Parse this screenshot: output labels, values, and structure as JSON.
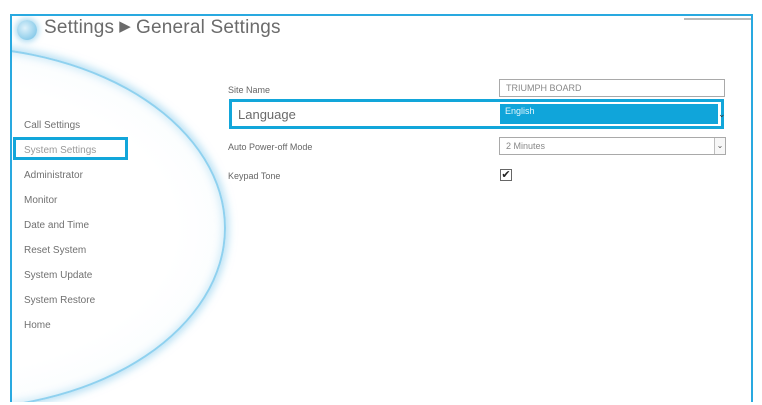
{
  "header": {
    "breadcrumb_root": "Settings",
    "breadcrumb_separator": "▶",
    "breadcrumb_current": "General Settings",
    "icon": "gear-icon"
  },
  "sidebar": {
    "items": [
      {
        "label": "Call Settings"
      },
      {
        "label": "System Settings",
        "active": true
      },
      {
        "label": "Administrator"
      },
      {
        "label": "Monitor"
      },
      {
        "label": "Date and Time"
      },
      {
        "label": "Reset System"
      },
      {
        "label": "System Update"
      },
      {
        "label": "System Restore"
      },
      {
        "label": "Home"
      }
    ]
  },
  "form": {
    "site_name": {
      "label": "Site Name",
      "value": "TRIUMPH BOARD"
    },
    "language": {
      "label": "Language",
      "value": "English"
    },
    "auto_power_off": {
      "label": "Auto Power-off Mode",
      "value": "2 Minutes"
    },
    "keypad_tone": {
      "label": "Keypad Tone",
      "checked": true,
      "check_glyph": "✔"
    }
  },
  "colors": {
    "accent": "#12a6da",
    "frame_border": "#29a9e0",
    "text": "#6b6b6b"
  }
}
